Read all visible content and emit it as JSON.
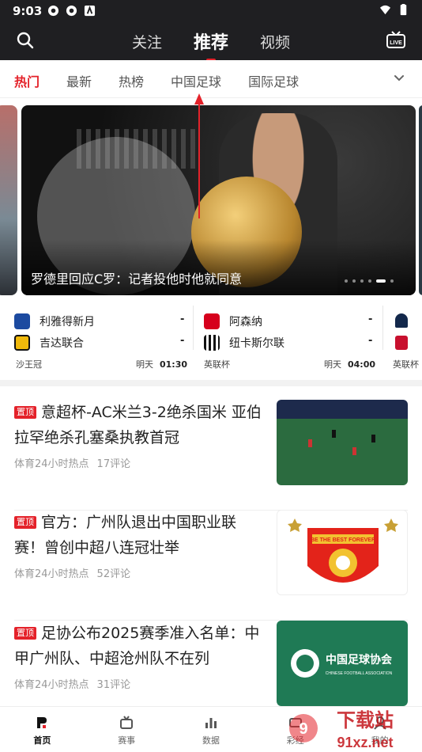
{
  "status_bar": {
    "time": "9:03",
    "icons": [
      "notification-icon",
      "notification-icon",
      "app-icon",
      "wifi-icon",
      "battery-icon"
    ]
  },
  "top_nav": {
    "tabs": [
      {
        "label": "关注"
      },
      {
        "label": "推荐",
        "active": true
      },
      {
        "label": "视频"
      }
    ],
    "live_icon": "LIVE"
  },
  "categories": [
    {
      "label": "热门",
      "active": true
    },
    {
      "label": "最新"
    },
    {
      "label": "热榜"
    },
    {
      "label": "中国足球"
    },
    {
      "label": "国际足球"
    }
  ],
  "carousel": {
    "caption": "罗德里回应C罗：记者投他时他就同意",
    "dot_count": 6,
    "active_dot": 4
  },
  "matches": [
    {
      "home": "利雅得新月",
      "away": "吉达联合",
      "home_score": "-",
      "away_score": "-",
      "league": "沙王冠",
      "day": "明天",
      "time": "01:30"
    },
    {
      "home": "阿森纳",
      "away": "纽卡斯尔联",
      "home_score": "-",
      "away_score": "-",
      "league": "英联杯",
      "day": "明天",
      "time": "04:00"
    },
    {
      "league": "英联杯"
    }
  ],
  "news": [
    {
      "tag": "置顶",
      "title": "意超杯-AC米兰3-2绝杀国米 亚伯拉罕绝杀孔塞桑执教首冠",
      "source": "体育24小时热点",
      "comments": "17评论"
    },
    {
      "tag": "置顶",
      "title": "官方：广州队退出中国职业联赛！曾创中超八连冠壮举",
      "source": "体育24小时热点",
      "comments": "52评论",
      "badge_text": "BE THE BEST FOREVER"
    },
    {
      "tag": "置顶",
      "title": "足协公布2025赛季准入名单：中甲广州队、中超沧州队不在列",
      "source": "体育24小时热点",
      "comments": "31评论",
      "logo_text": "中国足球协会",
      "logo_sub": "CHINESE FOOTBALL ASSOCIATION"
    }
  ],
  "bottom_tabs": [
    {
      "label": "首页",
      "active": true
    },
    {
      "label": "赛事"
    },
    {
      "label": "数据"
    },
    {
      "label": "彩经"
    },
    {
      "label": "我的"
    }
  ],
  "watermark": {
    "big": "下载站",
    "small": "91xz.net"
  },
  "colors": {
    "accent": "#e4222a",
    "dark": "#1f1f22"
  }
}
